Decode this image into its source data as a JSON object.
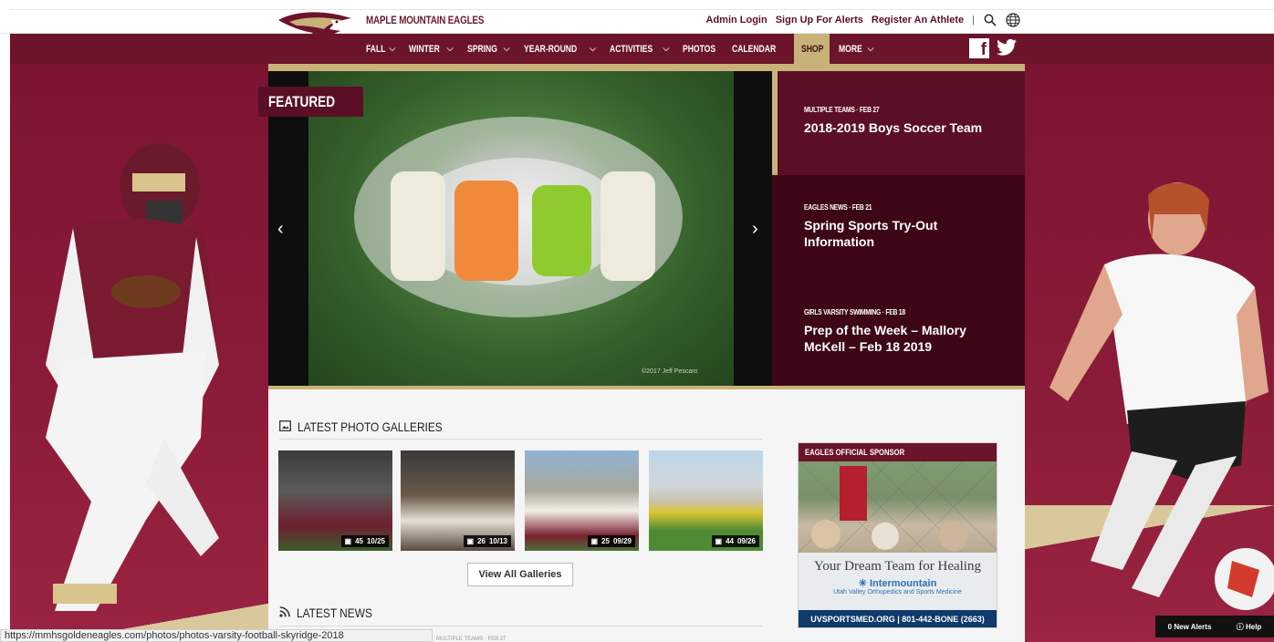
{
  "site": {
    "name": "MAPLE MOUNTAIN EAGLES"
  },
  "utility": {
    "admin": "Admin Login",
    "alerts": "Sign Up For Alerts",
    "register": "Register An Athlete",
    "sep": "|"
  },
  "nav": [
    {
      "label": "FALL",
      "chevron": "⌵"
    },
    {
      "label": "WINTER",
      "chevron": "⌵"
    },
    {
      "label": "SPRING",
      "chevron": "⌵"
    },
    {
      "label": "YEAR-ROUND",
      "chevron": "⌵"
    },
    {
      "label": "ACTIVITIES",
      "chevron": "⌵"
    },
    {
      "label": "PHOTOS",
      "chevron": ""
    },
    {
      "label": "CALENDAR",
      "chevron": ""
    },
    {
      "label": "SHOP",
      "chevron": ""
    },
    {
      "label": "MORE",
      "chevron": "⌵"
    }
  ],
  "social": {
    "facebook": "f"
  },
  "featured": {
    "tag": "FEATURED",
    "credit": "©2017 Jeff Pescaro",
    "prev": "‹",
    "next": "›"
  },
  "stories": [
    {
      "meta": "MULTIPLE TEAMS · FEB 27",
      "title": "2018-2019 Boys Soccer Team"
    },
    {
      "meta": "EAGLES NEWS · FEB 21",
      "title": "Spring Sports Try-Out Information"
    },
    {
      "meta": "GIRLS VARSITY SWIMMING · FEB 18",
      "title": "Prep of the Week – Mallory McKell – Feb 18 2019"
    }
  ],
  "galleries": {
    "heading": "LATEST PHOTO GALLERIES",
    "items": [
      {
        "count": "45",
        "date": "10/25"
      },
      {
        "count": "26",
        "date": "10/13"
      },
      {
        "count": "25",
        "date": "09/29"
      },
      {
        "count": "44",
        "date": "09/26"
      }
    ],
    "button": "View All Galleries"
  },
  "news": {
    "heading": "LATEST NEWS",
    "peek": "MULTIPLE TEAMS · FEB 27"
  },
  "sponsor": {
    "heading": "EAGLES OFFICIAL SPONSOR",
    "tagline": "Your Dream Team for Healing",
    "brand": "Intermountain",
    "brand_sub": "Utah Valley Orthopedics and Sports Medicine",
    "footer": "UVSPORTSMED.ORG | 801-442-BONE (2663)"
  },
  "status": {
    "url": "https://mmhsgoldeneagles.com/photos/photos-varsity-football-skyridge-2018",
    "alerts": "0 New Alerts",
    "help": "Help"
  },
  "colors": {
    "maroon": "#6c1429",
    "gold": "#c9b27a",
    "dark": "#3d0716"
  }
}
